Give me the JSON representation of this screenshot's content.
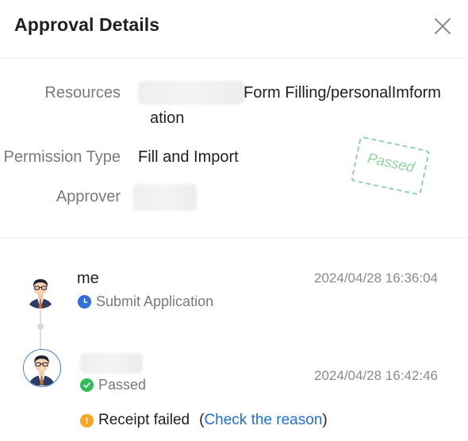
{
  "header": {
    "title": "Approval Details"
  },
  "info": {
    "resources_label": "Resources",
    "resources_value_line1": "Form Filling/personalImform",
    "resources_value_line2": "ation",
    "permission_label": "Permission Type",
    "permission_value": "Fill and Import",
    "approver_label": "Approver",
    "stamp_text": "Passed"
  },
  "timeline": {
    "step1": {
      "name": "me",
      "time": "2024/04/28 16:36:04",
      "status": "Submit Application"
    },
    "step2": {
      "time": "2024/04/28 16:42:46",
      "status": "Passed",
      "receipt_text": "Receipt failed",
      "open_paren": "(",
      "check_link": "Check the reason",
      "close_paren": ")"
    }
  },
  "colors": {
    "accent": "#1f6fe0",
    "success": "#2fbf57",
    "warning": "#f5a623",
    "stamp": "#8fd3a2"
  }
}
